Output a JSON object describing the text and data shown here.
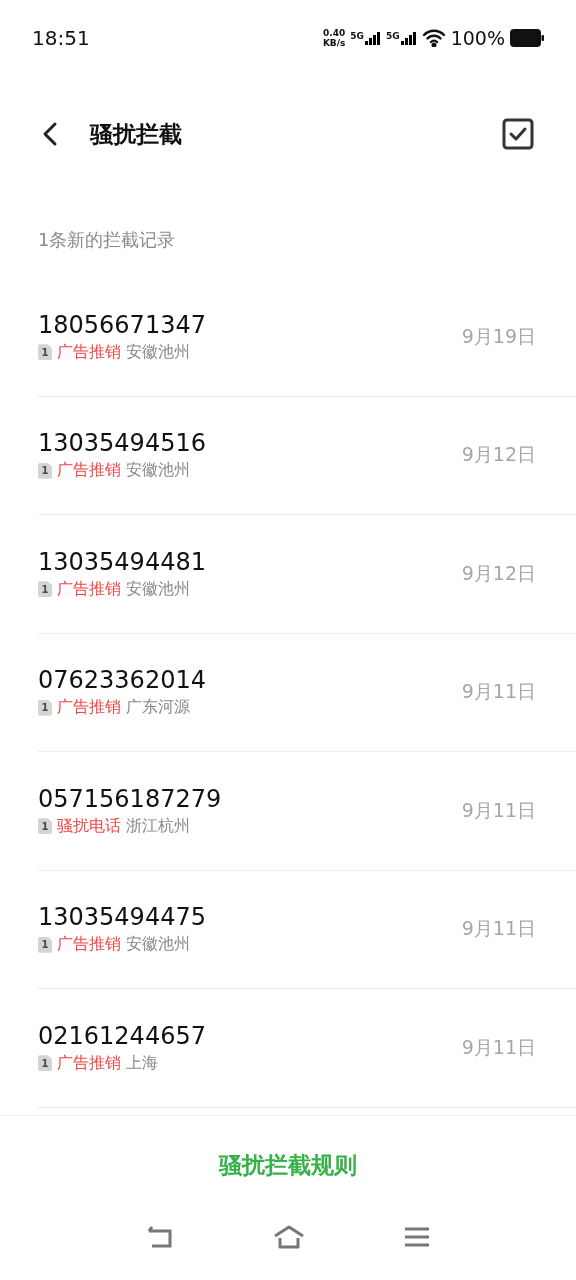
{
  "status_bar": {
    "time": "18:51",
    "speed": "0.40",
    "speed_unit": "KB/s",
    "network_1": "5G",
    "network_2": "5G",
    "battery": "100%"
  },
  "header": {
    "title": "骚扰拦截"
  },
  "summary": "1条新的拦截记录",
  "records": [
    {
      "number": "18056671347",
      "sim": "1",
      "tag": "广告推销",
      "location": "安徽池州",
      "date": "9月19日"
    },
    {
      "number": "13035494516",
      "sim": "1",
      "tag": "广告推销",
      "location": "安徽池州",
      "date": "9月12日"
    },
    {
      "number": "13035494481",
      "sim": "1",
      "tag": "广告推销",
      "location": "安徽池州",
      "date": "9月12日"
    },
    {
      "number": "07623362014",
      "sim": "1",
      "tag": "广告推销",
      "location": "广东河源",
      "date": "9月11日"
    },
    {
      "number": "057156187279",
      "sim": "1",
      "tag": "骚扰电话",
      "location": "浙江杭州",
      "date": "9月11日"
    },
    {
      "number": "13035494475",
      "sim": "1",
      "tag": "广告推销",
      "location": "安徽池州",
      "date": "9月11日"
    },
    {
      "number": "02161244657",
      "sim": "1",
      "tag": "广告推销",
      "location": "上海",
      "date": "9月11日"
    }
  ],
  "rules_button": "骚扰拦截规则"
}
